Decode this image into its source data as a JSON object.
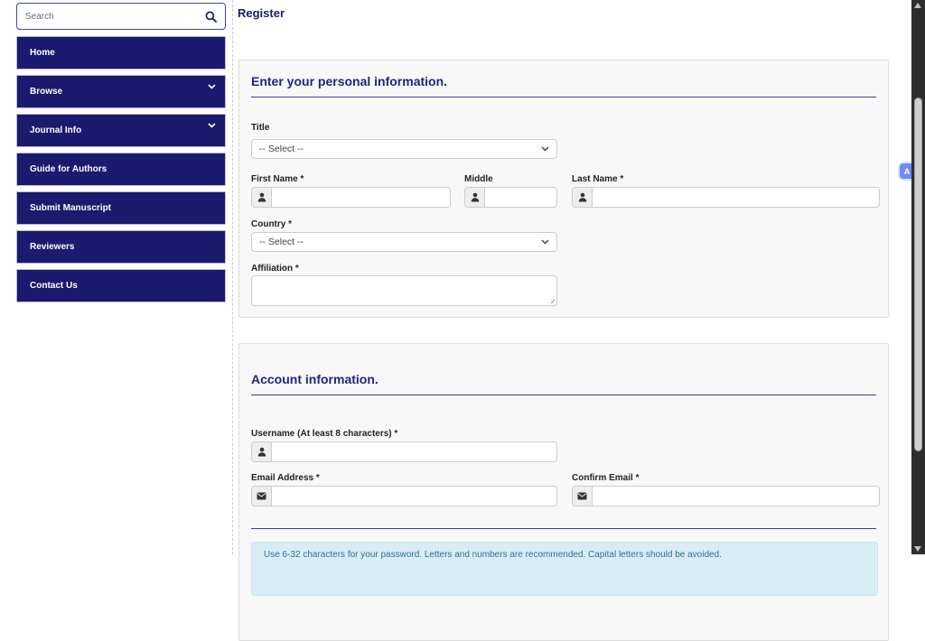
{
  "window": {
    "title": "Register"
  },
  "sidebar": {
    "search": {
      "placeholder": "Search"
    },
    "items": [
      {
        "label": "Home"
      },
      {
        "label": "Browse"
      },
      {
        "label": "Journal Info"
      },
      {
        "label": "Guide for Authors"
      },
      {
        "label": "Submit Manuscript"
      },
      {
        "label": "Reviewers"
      },
      {
        "label": "Contact Us"
      }
    ]
  },
  "personal": {
    "heading": "Enter your personal information.",
    "title_label": "Title",
    "title_value": "-- Select --",
    "first_name_label": "First Name *",
    "middle_label": "Middle",
    "last_name_label": "Last Name *",
    "country_label": "Country *",
    "country_value": "-- Select --",
    "affiliation_label": "Affiliation *"
  },
  "account": {
    "heading": "Account information.",
    "username_label": "Username (At least 8 characters) *",
    "email_label": "Email Address *",
    "confirm_email_label": "Confirm Email *",
    "password_note": "Use 6-32 characters for your password. Letters and numbers are recommended. Capital letters should be avoided."
  },
  "colors": {
    "navy": "#1a1a6e",
    "heading_navy": "#24247c",
    "rule": "#3d3d8f",
    "info_bg": "#d9edf7",
    "badge_blue": "#6d8df5"
  },
  "widgets": {
    "translate_badge_glyph": "A"
  }
}
